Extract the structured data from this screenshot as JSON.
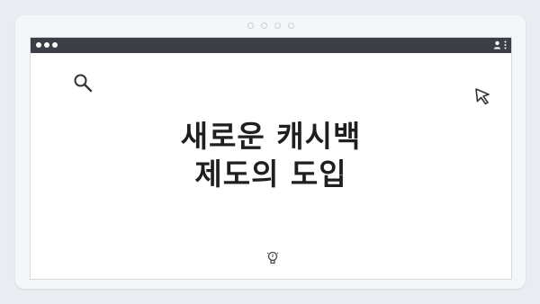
{
  "title": {
    "line1": "새로운 캐시백",
    "line2": "제도의 도입"
  },
  "colors": {
    "background": "#e9edf1",
    "frame": "#f4f6f8",
    "titlebar": "#3c3f45",
    "window": "#ffffff",
    "text": "#1f1f1f"
  },
  "icons": {
    "top_left": "search-icon",
    "top_right": "cursor-icon",
    "bottom": "lightbulb-icon",
    "titlebar_right": [
      "user-icon",
      "menu-icon"
    ]
  }
}
